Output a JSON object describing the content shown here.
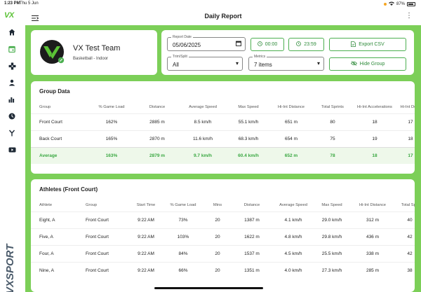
{
  "status_bar": {
    "time": "1:23 PM",
    "date": "Thu 5 Jun",
    "battery": "87%"
  },
  "app": {
    "logo": "VX",
    "brand_vertical": "VXSPORT"
  },
  "header": {
    "title": "Daily Report"
  },
  "team": {
    "name": "VX Test Team",
    "subtitle": "Basketball - Indoor"
  },
  "controls": {
    "report_date": {
      "label": "Report Date",
      "value": "05/06/2025"
    },
    "start_time": "00:00",
    "end_time": "23:59",
    "export_label": "Export CSV",
    "trim_split": {
      "label": "Trim/Split",
      "value": "All"
    },
    "metrics": {
      "label": "Metrics",
      "value": "7 items"
    },
    "hide_group_label": "Hide Group"
  },
  "group_data": {
    "title": "Group Data",
    "columns": [
      "Group",
      "% Game Load",
      "Distance",
      "Average Speed",
      "Max Speed",
      "Hi-Int Distance",
      "Total Sprints",
      "Hi-Int Accelerations",
      "Hi-Int Dece"
    ],
    "rows": [
      [
        "Front Court",
        "162%",
        "2885 m",
        "8.5 km/h",
        "55.1 km/h",
        "651 m",
        "80",
        "18",
        "17"
      ],
      [
        "Back Court",
        "165%",
        "2870 m",
        "11.6 km/h",
        "68.3 km/h",
        "654 m",
        "75",
        "19",
        "18"
      ],
      [
        "Average",
        "163%",
        "2879 m",
        "9.7 km/h",
        "60.4 km/h",
        "652 m",
        "78",
        "18",
        "17"
      ]
    ]
  },
  "athletes": {
    "title": "Athletes (Front Court)",
    "columns": [
      "Athlete",
      "Group",
      "Start Time",
      "% Game Load",
      "Mins",
      "Distance",
      "Average Speed",
      "Max Speed",
      "Hi-Int Distance",
      "Total Spri"
    ],
    "rows": [
      [
        "Eight, A",
        "Front Court",
        "9:22 AM",
        "73%",
        "20",
        "1387 m",
        "4.1 km/h",
        "29.0 km/h",
        "312 m",
        "40"
      ],
      [
        "Five, A",
        "Front Court",
        "9:22 AM",
        "103%",
        "20",
        "1622 m",
        "4.8 km/h",
        "29.8 km/h",
        "436 m",
        "42"
      ],
      [
        "Four, A",
        "Front Court",
        "9:22 AM",
        "84%",
        "20",
        "1537 m",
        "4.5 km/h",
        "25.5 km/h",
        "338 m",
        "42"
      ],
      [
        "Nine, A",
        "Front Court",
        "9:22 AM",
        "66%",
        "20",
        "1351 m",
        "4.0 km/h",
        "27.3 km/h",
        "285 m",
        "38"
      ]
    ]
  },
  "colors": {
    "accent": "#4caf50",
    "background": "#7ccf58",
    "average_row": "#3aa842"
  }
}
